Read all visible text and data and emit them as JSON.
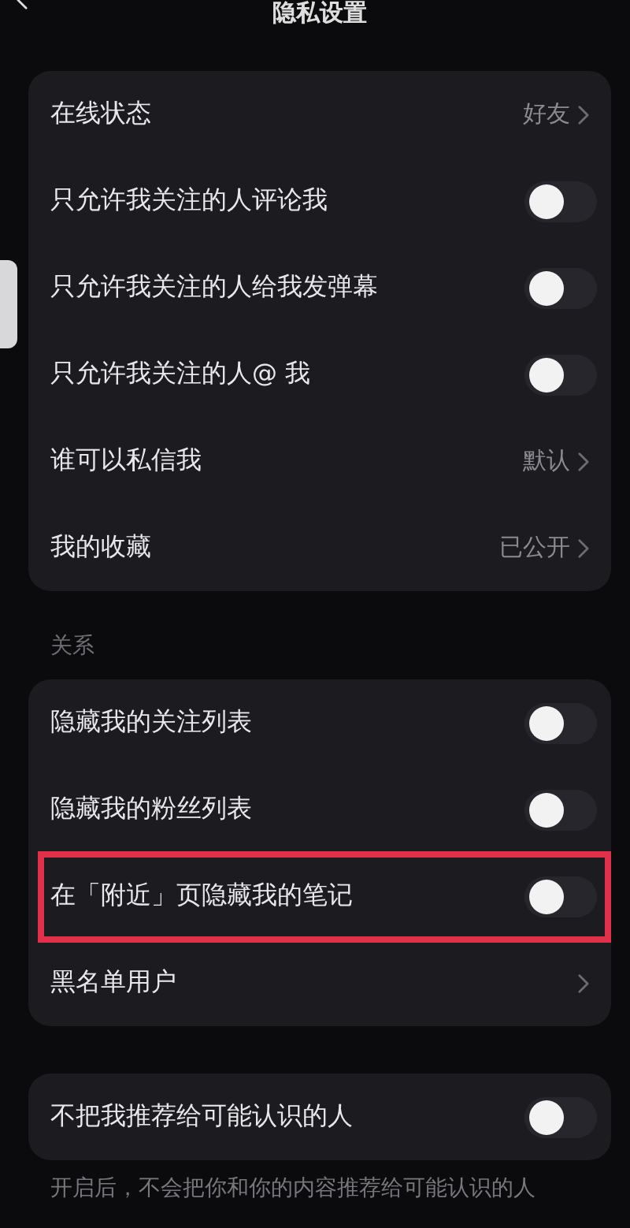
{
  "header": {
    "title": "隐私设置"
  },
  "sections": [
    {
      "items": [
        {
          "kind": "link",
          "label": "在线状态",
          "value": "好友"
        },
        {
          "kind": "toggle",
          "label": "只允许我关注的人评论我",
          "on": false
        },
        {
          "kind": "toggle",
          "label": "只允许我关注的人给我发弹幕",
          "on": false
        },
        {
          "kind": "toggle",
          "label": "只允许我关注的人@ 我",
          "on": false
        },
        {
          "kind": "link",
          "label": "谁可以私信我",
          "value": "默认"
        },
        {
          "kind": "link",
          "label": "我的收藏",
          "value": "已公开"
        }
      ]
    },
    {
      "title": "关系",
      "items": [
        {
          "kind": "toggle",
          "label": "隐藏我的关注列表",
          "on": false
        },
        {
          "kind": "toggle",
          "label": "隐藏我的粉丝列表",
          "on": false
        },
        {
          "kind": "toggle",
          "label": "在「附近」页隐藏我的笔记",
          "on": false,
          "highlighted": true
        },
        {
          "kind": "link",
          "label": "黑名单用户"
        }
      ]
    },
    {
      "items": [
        {
          "kind": "toggle",
          "label": "不把我推荐给可能认识的人",
          "on": false
        }
      ],
      "note": "开启后，不会把你和你的内容推荐给可能认识的人"
    }
  ]
}
